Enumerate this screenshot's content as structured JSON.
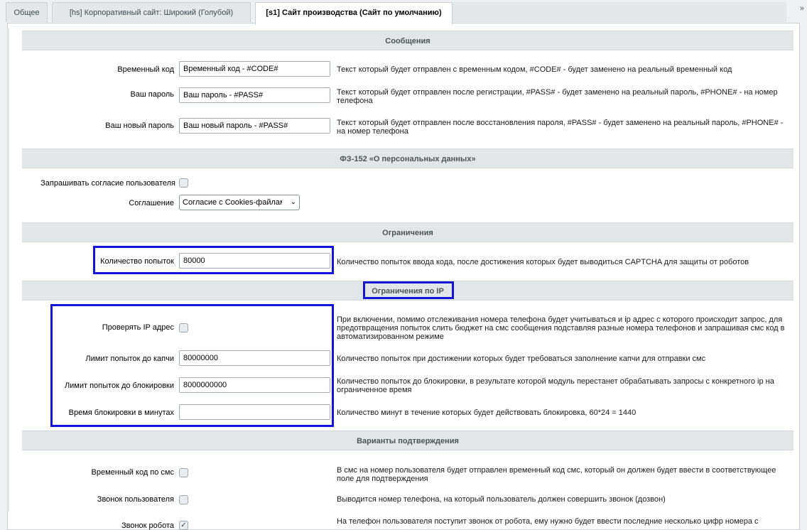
{
  "tabs": [
    {
      "label": "Общее"
    },
    {
      "label": "[hs] Корпоративный сайт: Широкий (Голубой)"
    },
    {
      "label": "[s1] Сайт производства (Сайт по умолчанию)"
    }
  ],
  "close_glyph": "»",
  "sections": {
    "messages": "Сообщения",
    "personal_data": "ФЗ-152 «О персональных данных»",
    "limits": "Ограничения",
    "ip_limits": "Ограничения по IP",
    "confirm_variants": "Варианты подтверждения"
  },
  "messages": {
    "temp_code": {
      "label": "Временный код",
      "value": "Временный код - #CODE#",
      "desc": "Текст который будет отправлен с временным кодом, #CODE# - будет заменено на реальный временный код"
    },
    "your_password": {
      "label": "Ваш пароль",
      "value": "Ваш пароль - #PASS#",
      "desc": "Текст который будет отправлен после регистрации, #PASS# - будет заменено на реальный пароль, #PHONE# - на номер телефона"
    },
    "your_new_password": {
      "label": "Ваш новый пароль",
      "value": "Ваш новый пароль - #PASS#",
      "desc": "Текст который будет отправлен после восстановления пароля, #PASS# - будет заменено на реальный пароль, #PHONE# - на номер телефона"
    }
  },
  "personal_data": {
    "ask_consent": {
      "label": "Запрашивать согласие пользователя",
      "checked": false
    },
    "agreement": {
      "label": "Соглашение",
      "selected": "Согласие с Cookies-файлами"
    }
  },
  "limits": {
    "attempts": {
      "label": "Количество попыток",
      "value": "80000",
      "desc": "Количество попыток ввода кода, после достижения которых будет выводиться CAPTCHA для защиты от роботов"
    }
  },
  "ip_limits": {
    "check_ip": {
      "label": "Проверять IP адрес",
      "checked": false,
      "desc": "При включении, помимо отслеживания номера телефона будет учитываться и ip адрес с которого происходит запрос, для предотвращения попыток слить бюджет на смс сообщения подставляя разные номера телефонов и запрашивая смс код в автоматизированном режиме"
    },
    "captcha_limit": {
      "label": "Лимит попыток до капчи",
      "value": "80000000",
      "desc": "Количество попыток при достижении которых будет требоваться заполнение капчи для отправки смс"
    },
    "block_limit": {
      "label": "Лимит попыток до блокировки",
      "value": "8000000000",
      "desc": "Количество попыток до блокировки, в результате которой модуль перестанет обрабатывать запросы с конкретного ip на ограниченное время"
    },
    "block_minutes": {
      "label": "Время блокировки в минутах",
      "value": "",
      "desc": "Количество минут в течение которых будет действовать блокировка, 60*24 = 1440"
    }
  },
  "confirm": {
    "sms_code": {
      "label": "Временный код по смс",
      "checked": false,
      "desc": "В смс на номер пользователя будет отправлен временный код смс, который он должен будет ввести в соответствующее поле для подтверждения"
    },
    "user_call": {
      "label": "Звонок пользователя",
      "checked": false,
      "desc": "Выводится номер телефона, на который пользователь должен совершить звонок (дозвон)"
    },
    "robot_call": {
      "label": "Звонок робота",
      "checked": true,
      "desc": "На телефон пользователя поступит звонок от робота, ему нужно будет ввести последние несколько цифр номера с"
    }
  },
  "checkmark_glyph": "✓",
  "dropdown_glyph": "⌄",
  "colors": {
    "highlight": "#1414d8",
    "section_bg": "#e1e6e8"
  }
}
